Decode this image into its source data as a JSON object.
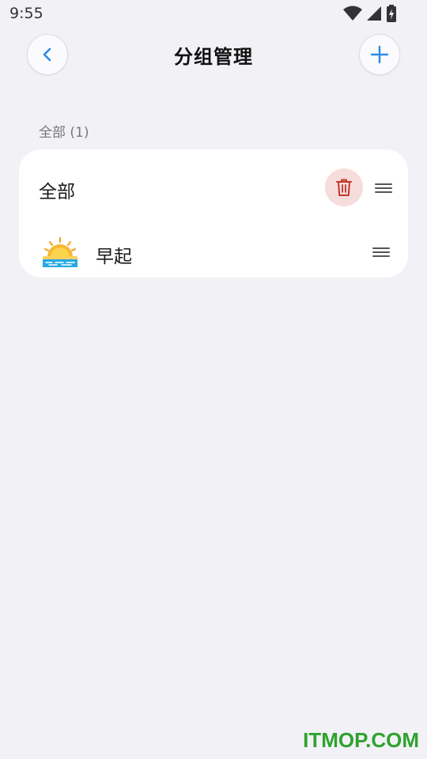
{
  "status_bar": {
    "time": "9:55",
    "icons": [
      "wifi-icon",
      "cellular-signal-icon",
      "battery-charging-icon"
    ]
  },
  "header": {
    "title": "分组管理",
    "back_icon": "chevron-left-icon",
    "add_icon": "plus-icon"
  },
  "section": {
    "label": "全部 (1)"
  },
  "groups": [
    {
      "label": "全部",
      "has_delete": true,
      "delete_icon": "trash-icon",
      "handle_icon": "drag-handle-icon"
    },
    {
      "label": "早起",
      "icon": "sunrise-icon",
      "handle_icon": "drag-handle-icon"
    }
  ],
  "colors": {
    "background": "#f2f1f6",
    "card": "#ffffff",
    "accent": "#2b8ae6",
    "delete_bg": "#f7dcdc",
    "delete_icon": "#c0392b",
    "watermark": "#2ea32e"
  },
  "watermark": {
    "text": "ITMOP.COM"
  }
}
